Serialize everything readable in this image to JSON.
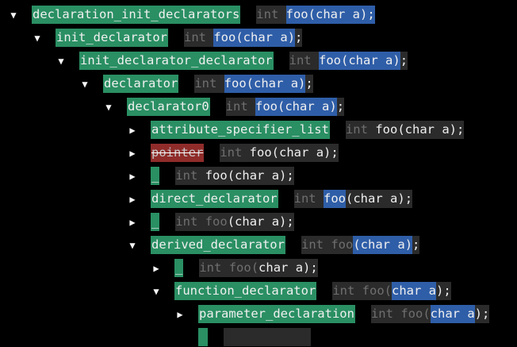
{
  "source": {
    "type_keyword": "int",
    "name": "foo",
    "paren_open": "(",
    "param_type": "char",
    "param_name": "a",
    "paren_close": ")",
    "semicolon": ";"
  },
  "nodes": [
    {
      "label": "declaration_init_declarators",
      "state": "ok",
      "toggle": "expanded",
      "highlight": "all"
    },
    {
      "label": "init_declarator",
      "state": "ok",
      "toggle": "expanded",
      "highlight": "decl"
    },
    {
      "label": "init_declarator_declarator",
      "state": "ok",
      "toggle": "expanded",
      "highlight": "decl"
    },
    {
      "label": "declarator",
      "state": "ok",
      "toggle": "expanded",
      "highlight": "decl"
    },
    {
      "label": "declarator0",
      "state": "ok",
      "toggle": "expanded",
      "highlight": "decl"
    },
    {
      "label": "attribute_specifier_list",
      "state": "ok",
      "toggle": "collapsed",
      "highlight": "none"
    },
    {
      "label": "pointer",
      "state": "error",
      "toggle": "collapsed",
      "highlight": "none"
    },
    {
      "label": "_",
      "state": "ok",
      "toggle": "collapsed",
      "highlight": "none"
    },
    {
      "label": "direct_declarator",
      "state": "ok",
      "toggle": "collapsed",
      "highlight": "name"
    },
    {
      "label": "_",
      "state": "ok",
      "toggle": "collapsed",
      "highlight": "none"
    },
    {
      "label": "derived_declarator",
      "state": "ok",
      "toggle": "expanded",
      "highlight": "params"
    },
    {
      "label": "_",
      "state": "ok",
      "toggle": "collapsed",
      "highlight": "none"
    },
    {
      "label": "function_declarator",
      "state": "ok",
      "toggle": "expanded",
      "highlight": "params"
    },
    {
      "label": "parameter_declaration",
      "state": "ok",
      "toggle": "collapsed",
      "highlight": "param"
    }
  ],
  "icons": {
    "expanded": "▼",
    "collapsed": "▶"
  },
  "colors": {
    "node_ok": "#2a8f63",
    "node_error": "#8f2c2a",
    "source_highlight": "#2f5ea8",
    "source_bg": "#2b2b2b"
  }
}
